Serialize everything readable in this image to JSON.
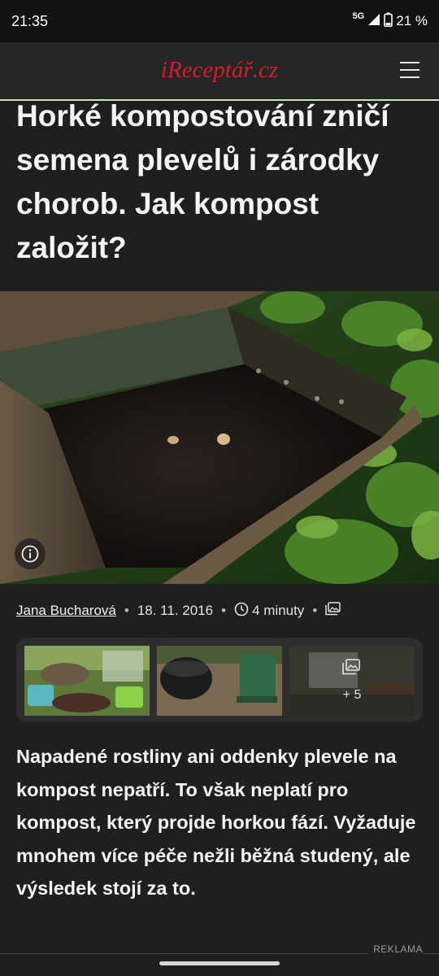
{
  "status_bar": {
    "time": "21:35",
    "network": "5G",
    "battery": "21 %"
  },
  "header": {
    "logo": "iReceptář.cz"
  },
  "article": {
    "title": "Horké kompostování zničí semena plevelů i zárodky chorob. Jak kompost založit?",
    "hero_icon": "info-icon",
    "author": "Jana Bucharová",
    "date": "18. 11. 2016",
    "read_time": "4 minuty",
    "gallery": {
      "more_count": "+ 5"
    },
    "lead": "Napadené rostliny ani oddenky plevele na kompost nepatří. To však neplatí pro kompost, který projde horkou fází. Vyžaduje mnohem více péče nežli běžná studený, ale výsledek stojí za to."
  },
  "ad": {
    "label": "REKLAMA"
  },
  "colors": {
    "logo_red": "#d41f2b",
    "background": "#1f1f1f",
    "header_line": "#c9e4b9"
  }
}
